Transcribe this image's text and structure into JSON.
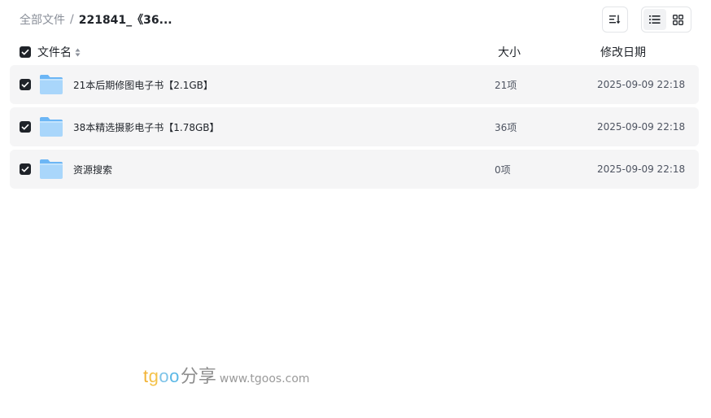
{
  "breadcrumb": {
    "root": "全部文件",
    "separator": "/",
    "current": "221841_《36..."
  },
  "toolbar": {
    "sort_icon": "sort-icon",
    "list_view_icon": "list-view-icon",
    "grid_view_icon": "grid-view-icon",
    "active_view": "list"
  },
  "table": {
    "headers": {
      "name": "文件名",
      "size": "大小",
      "date": "修改日期"
    },
    "rows": [
      {
        "name": "21本后期修图电子书【2.1GB】",
        "size": "21项",
        "date": "2025-09-09 22:18",
        "checked": true,
        "icon": "folder-icon"
      },
      {
        "name": "38本精选摄影电子书【1.78GB】",
        "size": "36项",
        "date": "2025-09-09 22:18",
        "checked": true,
        "icon": "folder-icon"
      },
      {
        "name": "资源搜索",
        "size": "0项",
        "date": "2025-09-09 22:18",
        "checked": true,
        "icon": "folder-icon"
      }
    ]
  },
  "watermark": {
    "brand": "tgoo",
    "cn": "分享",
    "url": "www.tgoos.com",
    "colors": [
      "#f2b233",
      "#f4c24a",
      "#7fc4e8",
      "#5cb8e6"
    ]
  },
  "colors": {
    "row_bg": "#f5f5f6",
    "checkbox": "#1f2329",
    "folder_light": "#a9d6fb",
    "folder_dark": "#6cb6f5"
  }
}
